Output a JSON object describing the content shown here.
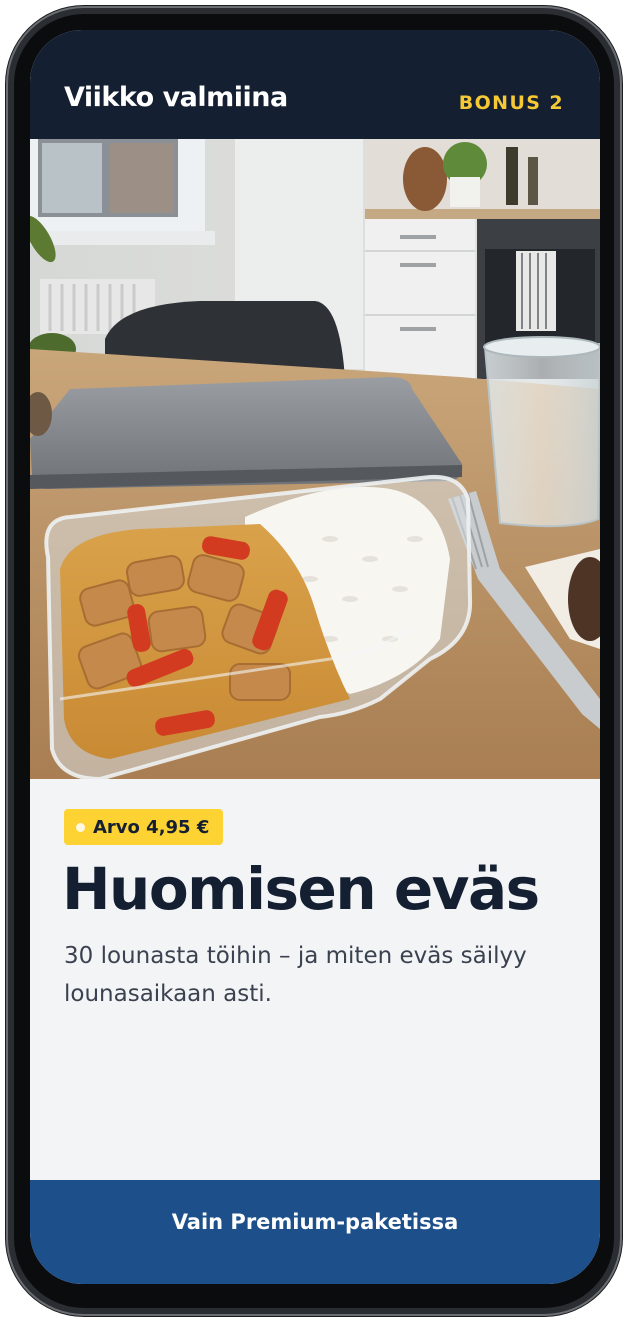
{
  "header": {
    "brand": "Viikko valmiina",
    "bonus": "BONUS 2"
  },
  "hero": {
    "image": "meal-prep-container-photo",
    "alt": "Lasirasia, jossa kanaa, paprikaa, kastiketta ja riisiä pöydällä läppärin vieressä"
  },
  "offer": {
    "value_badge": "Arvo 4,95 €",
    "title": "Huomisen eväs",
    "description": "30 lounasta töihin – ja miten eväs säilyy lounasaikaan asti."
  },
  "cta": {
    "label": "Vain Premium-paketissa"
  },
  "colors": {
    "header_bg": "#142032",
    "bonus_accent": "#f5c935",
    "badge_bg": "#fdd233",
    "cta_bg": "#1d4f8a",
    "content_bg": "#f3f4f6"
  }
}
